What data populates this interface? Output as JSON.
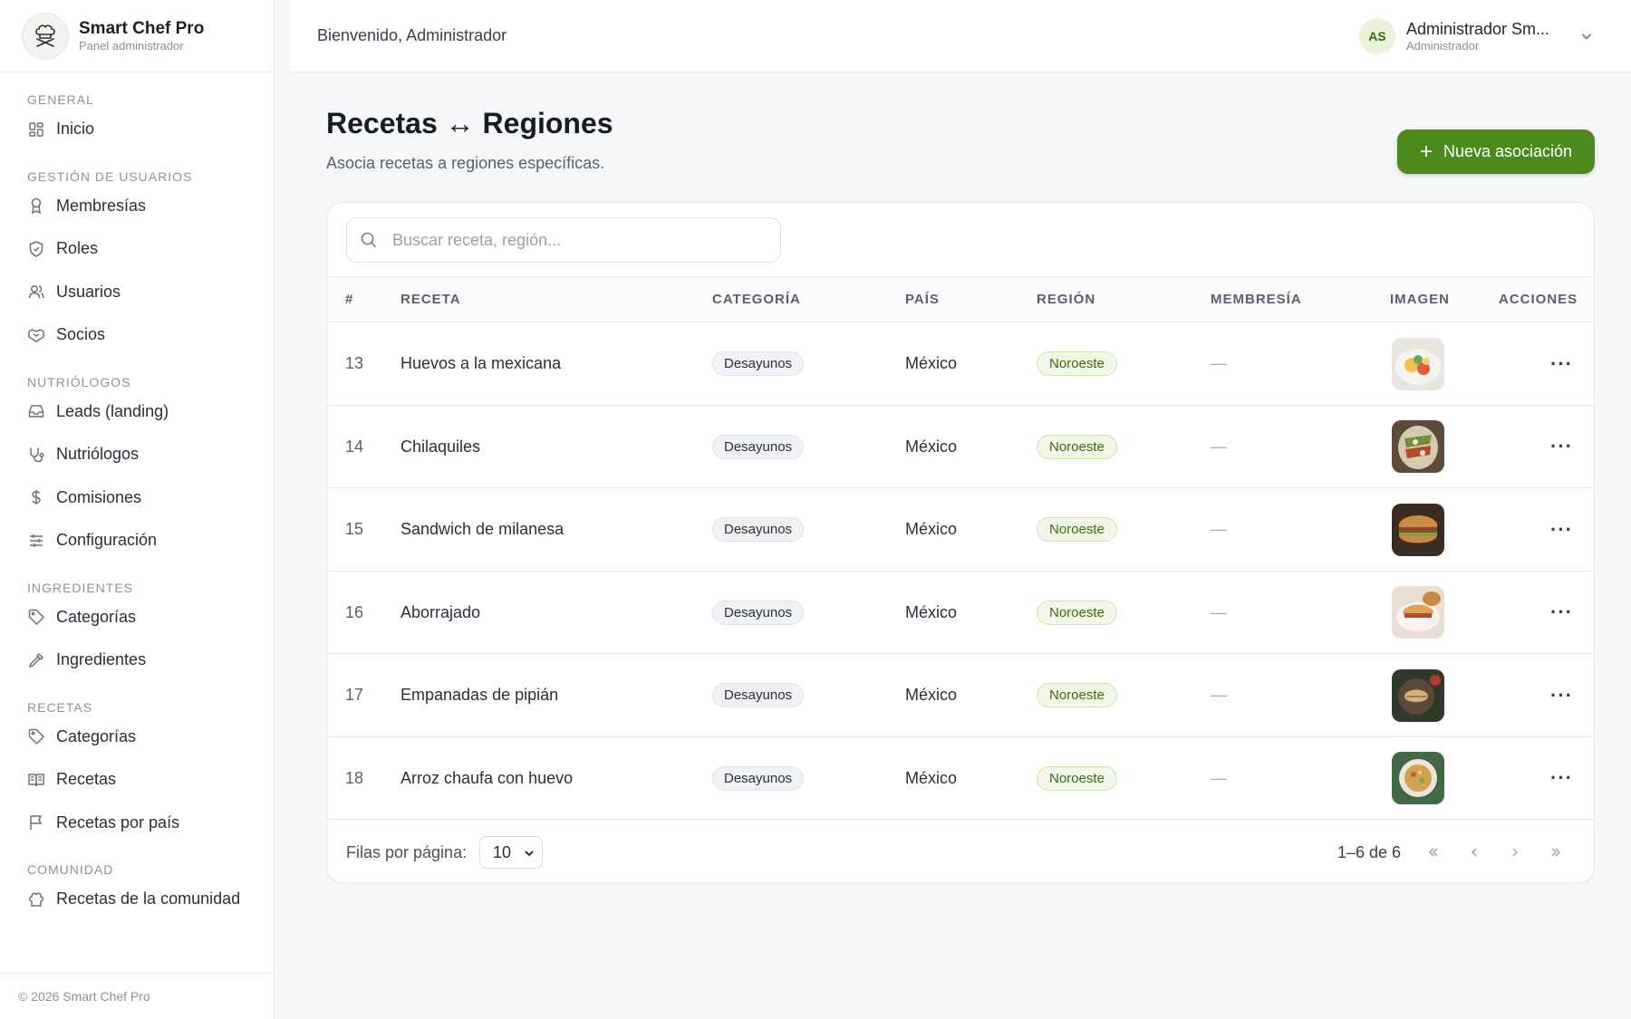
{
  "brand": {
    "name": "Smart Chef Pro",
    "subtitle": "Panel administrador"
  },
  "sidebar": {
    "sections": [
      {
        "title": "GENERAL",
        "items": [
          {
            "label": "Inicio",
            "icon": "grid-icon"
          }
        ]
      },
      {
        "title": "GESTIÓN DE USUARIOS",
        "items": [
          {
            "label": "Membresías",
            "icon": "award-icon"
          },
          {
            "label": "Roles",
            "icon": "shield-icon"
          },
          {
            "label": "Usuarios",
            "icon": "users-icon"
          },
          {
            "label": "Socios",
            "icon": "handshake-icon"
          }
        ]
      },
      {
        "title": "NUTRIÓLOGOS",
        "items": [
          {
            "label": "Leads (landing)",
            "icon": "inbox-icon"
          },
          {
            "label": "Nutriólogos",
            "icon": "stethoscope-icon"
          },
          {
            "label": "Comisiones",
            "icon": "dollar-icon"
          },
          {
            "label": "Configuración",
            "icon": "sliders-icon"
          }
        ]
      },
      {
        "title": "INGREDIENTES",
        "items": [
          {
            "label": "Categorías",
            "icon": "tag-icon"
          },
          {
            "label": "Ingredientes",
            "icon": "pipette-icon"
          }
        ]
      },
      {
        "title": "RECETAS",
        "items": [
          {
            "label": "Categorías",
            "icon": "tag-icon"
          },
          {
            "label": "Recetas",
            "icon": "book-icon"
          },
          {
            "label": "Recetas por país",
            "icon": "flag-icon"
          }
        ]
      },
      {
        "title": "COMUNIDAD",
        "items": [
          {
            "label": "Recetas de la comunidad",
            "icon": "chef-hat-icon"
          }
        ]
      }
    ],
    "footer": "© 2026 Smart Chef Pro"
  },
  "topbar": {
    "welcome": "Bienvenido, Administrador",
    "user": {
      "initials": "AS",
      "name": "Administrador Sm...",
      "role": "Administrador"
    }
  },
  "page": {
    "title": "Recetas ↔ Regiones",
    "subtitle": "Asocia recetas a regiones específicas.",
    "add_button": "Nueva asociación"
  },
  "search": {
    "placeholder": "Buscar receta, región..."
  },
  "table": {
    "columns": [
      "#",
      "RECETA",
      "CATEGORÍA",
      "PAÍS",
      "REGIÓN",
      "MEMBRESÍA",
      "IMAGEN",
      "ACCIONES"
    ],
    "rows": [
      {
        "id": "13",
        "receta": "Huevos a la mexicana",
        "categoria": "Desayunos",
        "pais": "México",
        "region": "Noroeste",
        "membresia": "—",
        "actions": "···"
      },
      {
        "id": "14",
        "receta": "Chilaquiles",
        "categoria": "Desayunos",
        "pais": "México",
        "region": "Noroeste",
        "membresia": "—",
        "actions": "···"
      },
      {
        "id": "15",
        "receta": "Sandwich de milanesa",
        "categoria": "Desayunos",
        "pais": "México",
        "region": "Noroeste",
        "membresia": "—",
        "actions": "···"
      },
      {
        "id": "16",
        "receta": "Aborrajado",
        "categoria": "Desayunos",
        "pais": "México",
        "region": "Noroeste",
        "membresia": "—",
        "actions": "···"
      },
      {
        "id": "17",
        "receta": "Empanadas de pipián",
        "categoria": "Desayunos",
        "pais": "México",
        "region": "Noroeste",
        "membresia": "—",
        "actions": "···"
      },
      {
        "id": "18",
        "receta": "Arroz chaufa con huevo",
        "categoria": "Desayunos",
        "pais": "México",
        "region": "Noroeste",
        "membresia": "—",
        "actions": "···"
      }
    ]
  },
  "pagination": {
    "rows_per_page_label": "Filas por página:",
    "rows_per_page": "10",
    "range": "1–6 de 6"
  },
  "colors": {
    "accent": "#4d8a1e",
    "region_badge_bg": "#f1f7e6",
    "region_badge_text": "#3e6a14"
  }
}
